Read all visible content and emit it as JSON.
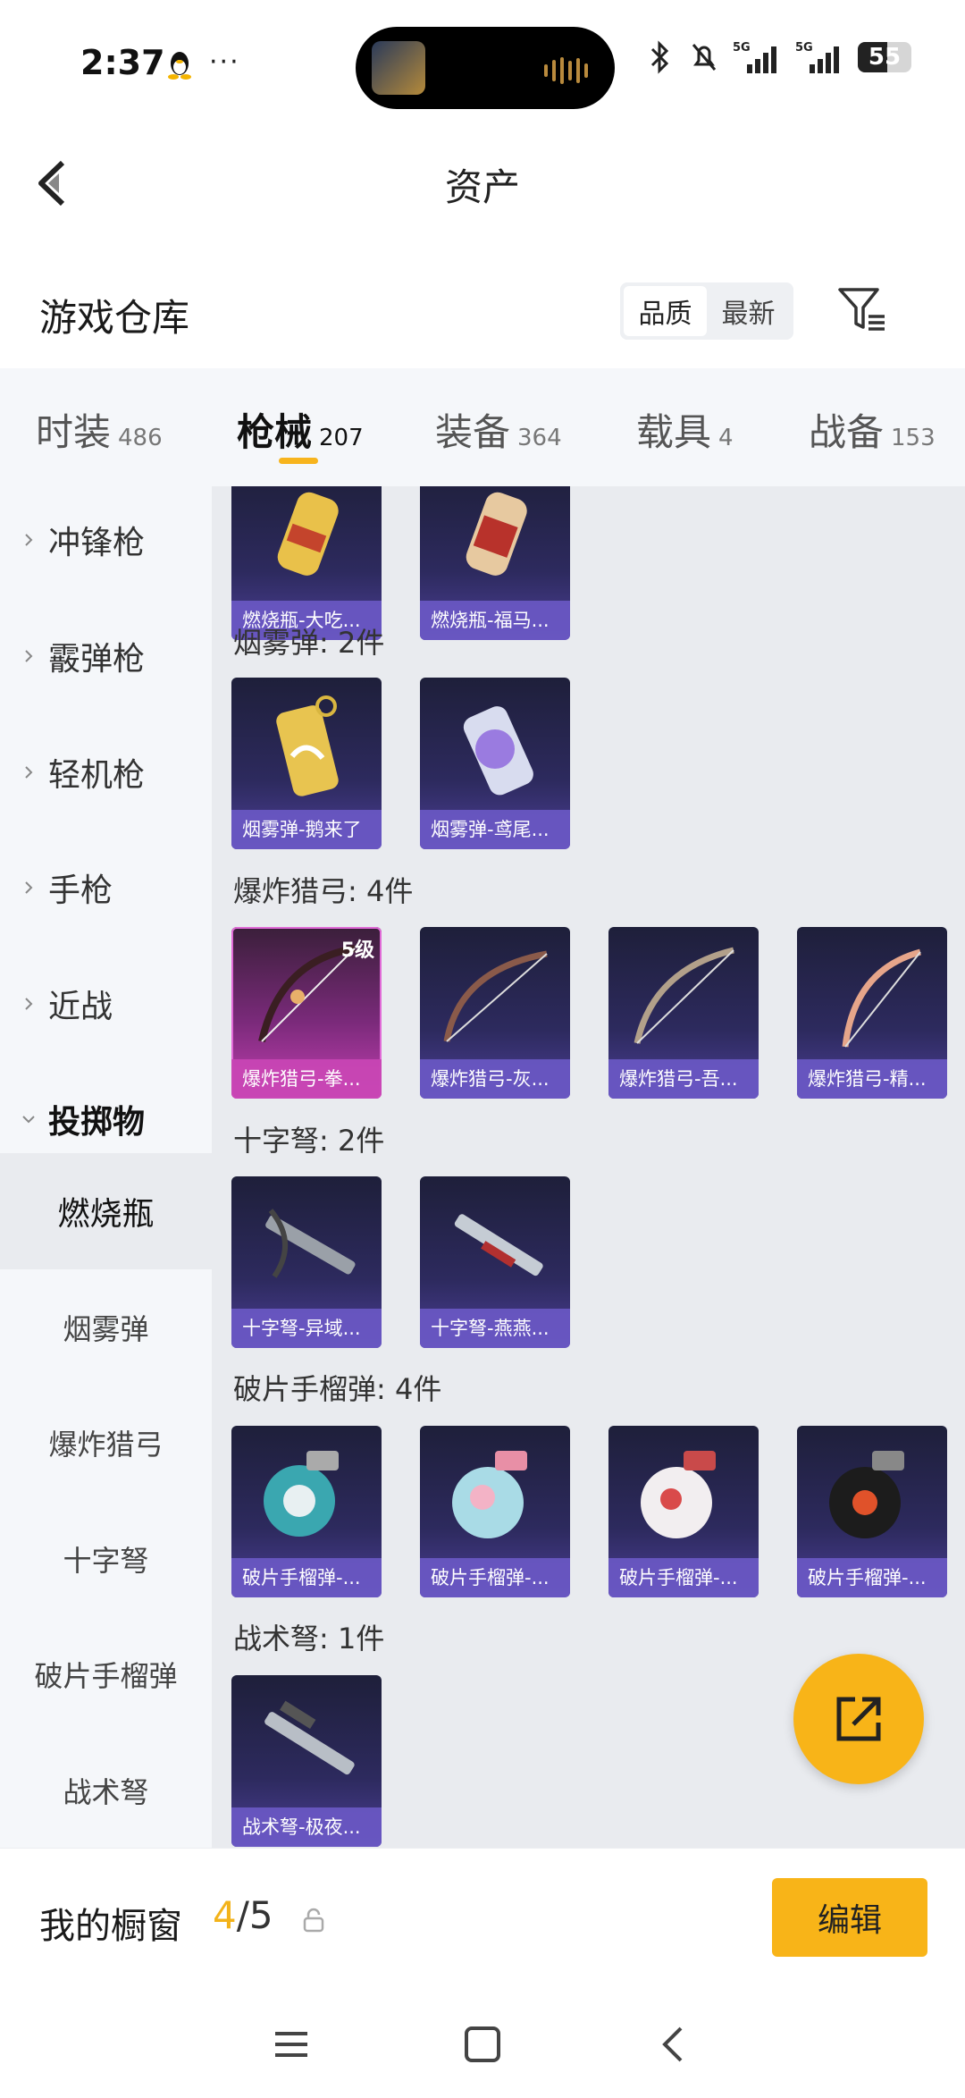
{
  "status_bar": {
    "time": "2:37",
    "dots": "···",
    "network_1": "5G",
    "network_2": "5G",
    "battery": "55",
    "battery_level": 0.55
  },
  "header": {
    "title": "资产"
  },
  "warehouse": {
    "title": "游戏仓库",
    "sort_options": [
      "品质",
      "最新"
    ],
    "active_sort": "品质"
  },
  "tabs": [
    {
      "label": "时装",
      "count": "486"
    },
    {
      "label": "枪械",
      "count": "207"
    },
    {
      "label": "装备",
      "count": "364"
    },
    {
      "label": "载具",
      "count": "4"
    },
    {
      "label": "战备",
      "count": "153"
    }
  ],
  "active_tab": "枪械",
  "sidebar": {
    "categories": [
      "冲锋枪",
      "霰弹枪",
      "轻机枪",
      "手枪",
      "近战",
      "投掷物"
    ],
    "subcategories": [
      "燃烧瓶",
      "烟雾弹",
      "爆炸猎弓",
      "十字弩",
      "破片手榴弹",
      "战术弩"
    ],
    "active_subcategory": "燃烧瓶"
  },
  "sections": {
    "molotov": {
      "items": [
        "燃烧瓶-大吃...",
        "燃烧瓶-福马..."
      ]
    },
    "smoke": {
      "title": "烟雾弹: 2件",
      "items": [
        "烟雾弹-鹅来了",
        "烟雾弹-鸢尾..."
      ]
    },
    "bow": {
      "title": "爆炸猎弓: 4件",
      "items": [
        "爆炸猎弓-拳...",
        "爆炸猎弓-灰...",
        "爆炸猎弓-吾...",
        "爆炸猎弓-精..."
      ],
      "level_badge": "5级"
    },
    "crossbow": {
      "title": "十字弩: 2件",
      "items": [
        "十字弩-异域...",
        "十字弩-燕燕..."
      ]
    },
    "grenade": {
      "title": "破片手榴弹: 4件",
      "items": [
        "破片手榴弹-...",
        "破片手榴弹-...",
        "破片手榴弹-...",
        "破片手榴弹-..."
      ]
    },
    "tactical": {
      "title": "战术弩: 1件",
      "items": [
        "战术弩-极夜..."
      ]
    }
  },
  "showcase": {
    "label": "我的橱窗",
    "used": "4",
    "total": "/5",
    "edit_label": "编辑"
  },
  "colors": {
    "accent": "#f8b418",
    "card_purple": "#4c3f96",
    "card_pink": "#c33fb1"
  },
  "icons": [
    "back-arrow-icon",
    "filter-icon",
    "share-external-icon",
    "lock-icon",
    "menu-icon",
    "home-square-icon",
    "nav-back-icon"
  ]
}
